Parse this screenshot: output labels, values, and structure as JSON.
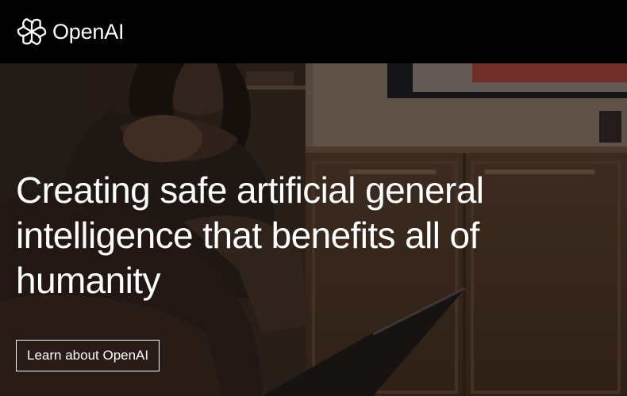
{
  "header": {
    "logo_text": "OpenAI",
    "logo_icon": "openai-logo-icon",
    "background": "#000000"
  },
  "hero": {
    "headline": "Creating safe artificial general intelligence that benefits all of humanity",
    "cta_label": "Learn about OpenAI",
    "text_color": "#ffffff"
  }
}
